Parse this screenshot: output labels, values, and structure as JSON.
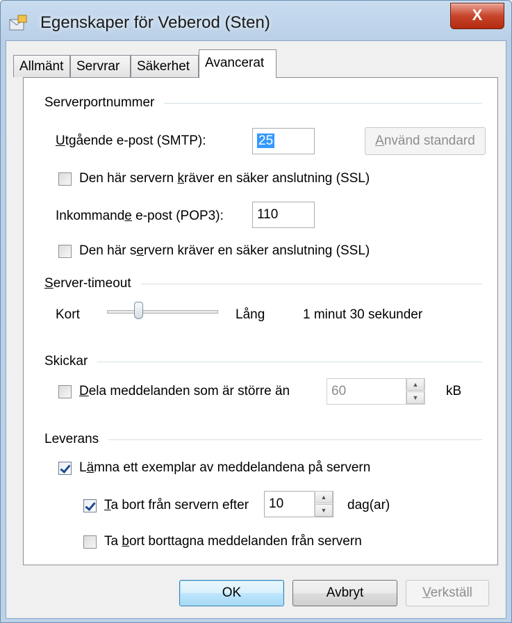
{
  "window": {
    "title": "Egenskaper för Veberod (Sten)",
    "close_label": "X"
  },
  "tabs": [
    {
      "label": "Allmänt"
    },
    {
      "label": "Servrar"
    },
    {
      "label": "Säkerhet"
    },
    {
      "label": "Avancerat"
    }
  ],
  "server_ports": {
    "group_label": "Serverportnummer",
    "smtp_label_accel": "U",
    "smtp_label_rest": "tgående e-post (SMTP):",
    "smtp_value": "25",
    "default_btn_accel": "A",
    "default_btn_rest": "nvänd standard",
    "ssl1_pre": "Den här servern ",
    "ssl1_accel": "k",
    "ssl1_post": "räver en säker anslutning (SSL)",
    "ssl1_checked": false,
    "pop3_label_pre": "Inkommand",
    "pop3_label_accel": "e",
    "pop3_label_post": " e-post (POP3):",
    "pop3_value": "110",
    "ssl2_pre": "Den här s",
    "ssl2_accel": "e",
    "ssl2_post": "rvern kräver en säker anslutning (SSL)",
    "ssl2_checked": false
  },
  "timeout": {
    "group_label_accel": "S",
    "group_label_rest": "erver-timeout",
    "short_label": "Kort",
    "long_label": "Lång",
    "value_text": "1 minut 30 sekunder",
    "slider_level": 0.27
  },
  "sending": {
    "group_label": "Skickar",
    "split_accel": "D",
    "split_rest": "ela meddelanden som är större än",
    "split_checked": false,
    "split_value": "60",
    "unit": "kB"
  },
  "delivery": {
    "group_label": "Leverans",
    "leave_pre": "L",
    "leave_accel": "ä",
    "leave_post": "mna ett exemplar av meddelandena på servern",
    "leave_checked": true,
    "remove_after_accel": "T",
    "remove_after_rest": "a bort från servern efter",
    "remove_after_checked": true,
    "days_value": "10",
    "days_unit": "dag(ar)",
    "remove_deleted_pre": "Ta ",
    "remove_deleted_accel": "b",
    "remove_deleted_post": "ort borttagna meddelanden från servern",
    "remove_deleted_checked": false
  },
  "buttons": {
    "ok": "OK",
    "cancel": "Avbryt",
    "apply_accel": "V",
    "apply_rest": "erkställ"
  }
}
